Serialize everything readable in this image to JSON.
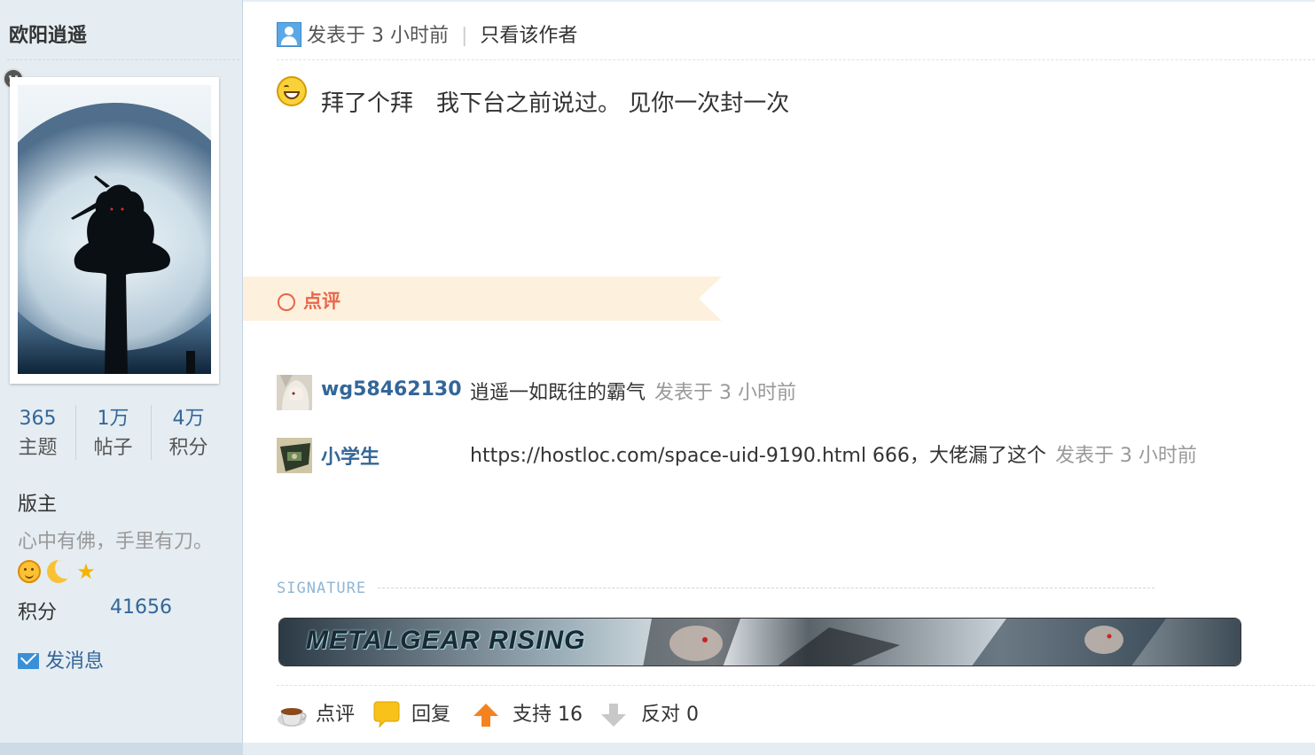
{
  "author": {
    "name": "欧阳逍遥",
    "stats": [
      {
        "value": "365",
        "label": "主题"
      },
      {
        "value": "1万",
        "label": "帖子"
      },
      {
        "value": "4万",
        "label": "积分"
      }
    ],
    "group": "版主",
    "custom_title": "心中有佛，手里有刀。",
    "level_icons": [
      "sun-icon",
      "moon-icon",
      "star-icon"
    ],
    "credit_label": "积分",
    "credit_value": "41656",
    "send_message": "发消息"
  },
  "post": {
    "posted_at": "发表于 3 小时前",
    "separator": "|",
    "only_author": "只看该作者",
    "content": "拜了个拜　我下台之前说过。 见你一次封一次"
  },
  "rating": {
    "title": "点评",
    "comments": [
      {
        "user": "wg58462130",
        "text": "逍遥一如既往的霸气",
        "time": "发表于 3 小时前"
      },
      {
        "user": "小学生",
        "text": "https://hostloc.com/space-uid-9190.html 666，大佬漏了这个",
        "time": "发表于 3 小时前"
      }
    ]
  },
  "signature": {
    "label": "SIGNATURE",
    "banner_text": "METALGEAR RISING"
  },
  "actions": {
    "rate": "点评",
    "reply": "回复",
    "support": "支持 16",
    "oppose": "反对 0"
  },
  "colors": {
    "sidebar_bg": "#e5edf2",
    "link_blue": "#336699",
    "rate_band": "#fdf0dd",
    "rate_accent": "#e8664a"
  }
}
